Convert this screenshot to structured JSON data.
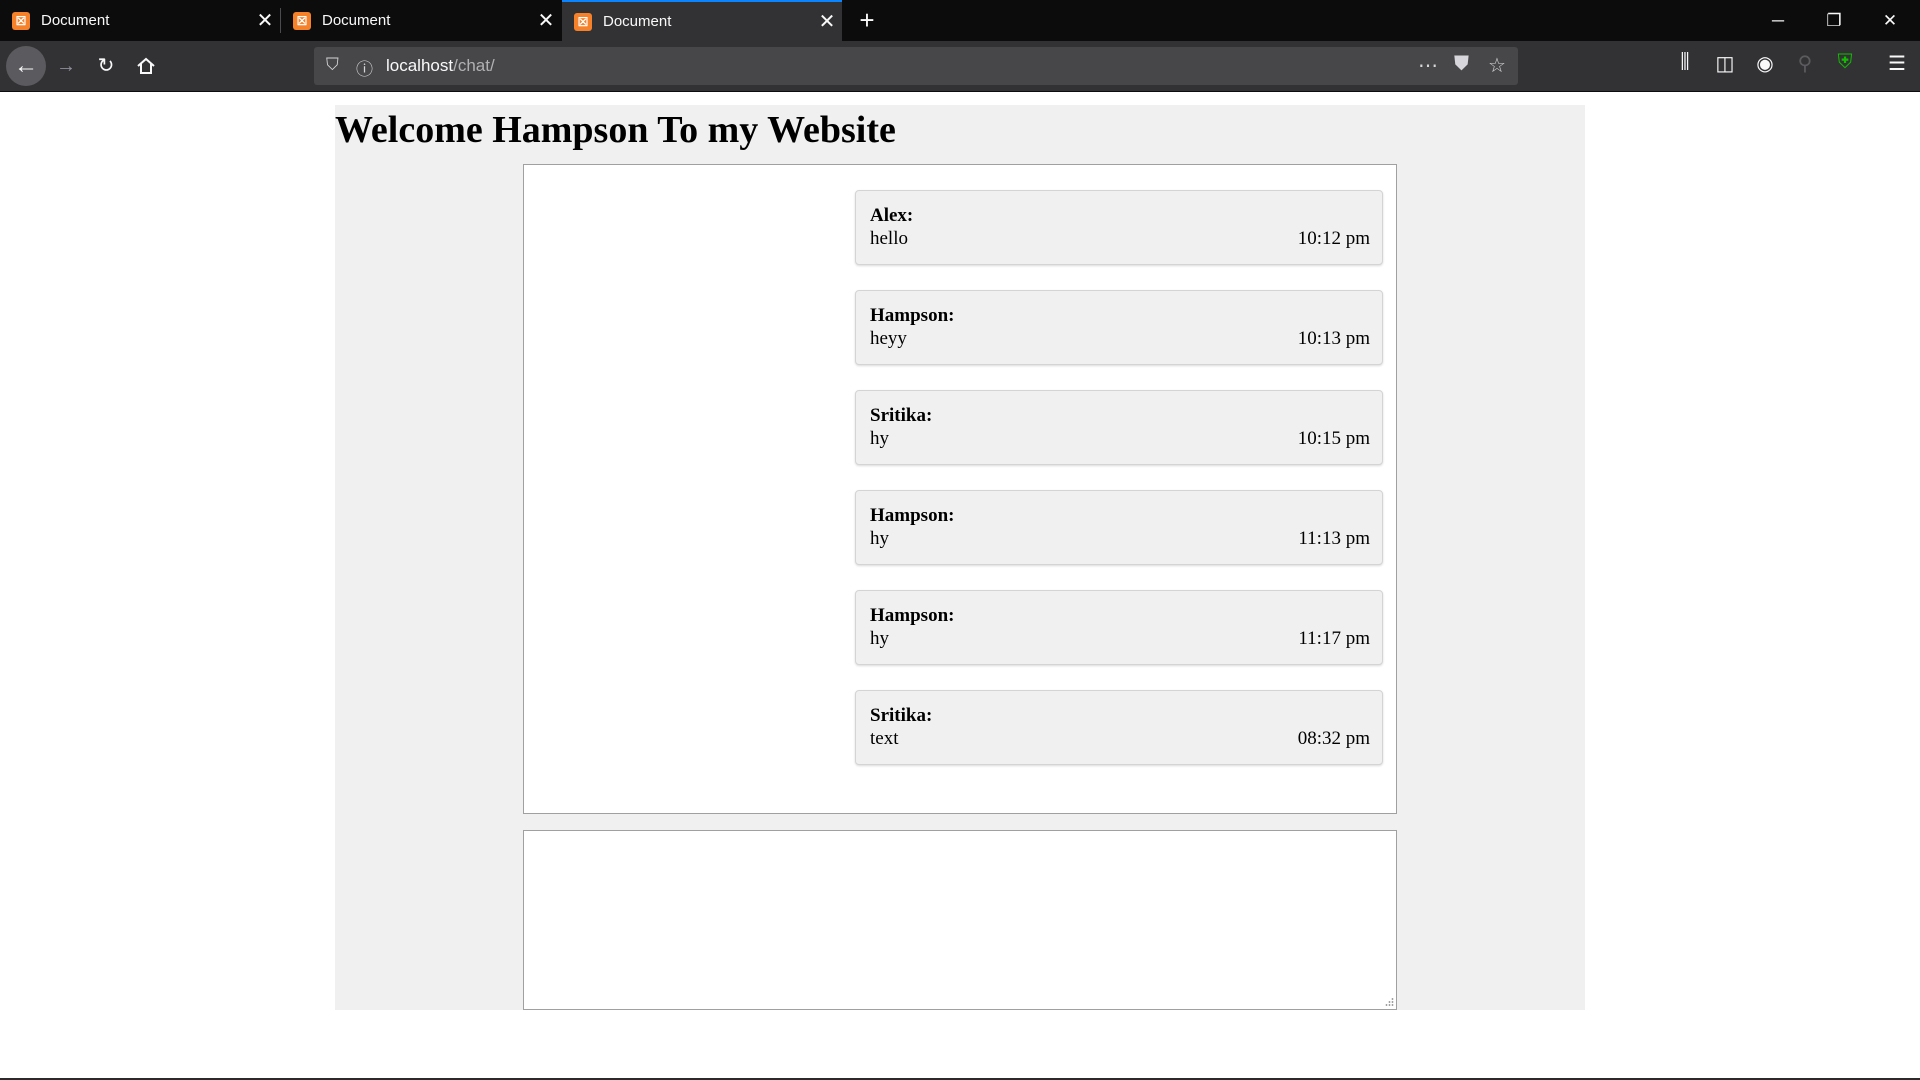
{
  "browser": {
    "tabs": [
      {
        "title": "Document",
        "active": false
      },
      {
        "title": "Document",
        "active": false
      },
      {
        "title": "Document",
        "active": true
      }
    ],
    "url_host": "localhost",
    "url_path": "/chat/",
    "icons": {
      "back": "arrow-left-icon",
      "forward": "arrow-right-icon",
      "reload": "reload-icon",
      "home": "home-icon",
      "tracking": "shield-icon",
      "info": "info-icon",
      "more": "more-icon",
      "pocket": "pocket-icon",
      "bookmark": "star-icon",
      "library": "library-icon",
      "sidebar": "sidebar-icon",
      "account": "account-icon",
      "menu": "menu-icon"
    }
  },
  "page": {
    "heading": "Welcome Hampson To my Website",
    "messages": [
      {
        "name": "Alex:",
        "text": "hello",
        "time": "10:12 pm"
      },
      {
        "name": "Hampson:",
        "text": "heyy",
        "time": "10:13 pm"
      },
      {
        "name": "Sritika:",
        "text": "hy",
        "time": "10:15 pm"
      },
      {
        "name": "Hampson:",
        "text": "hy",
        "time": "11:13 pm"
      },
      {
        "name": "Hampson:",
        "text": "hy",
        "time": "11:17 pm"
      },
      {
        "name": "Sritika:",
        "text": "text",
        "time": "08:32 pm"
      }
    ],
    "input_value": "",
    "input_placeholder": ""
  },
  "colors": {
    "page_background": "#f0f0f0",
    "message_background": "#f0f0f0",
    "active_tab_accent": "#0a84ff",
    "favicon": "#f5812a"
  }
}
